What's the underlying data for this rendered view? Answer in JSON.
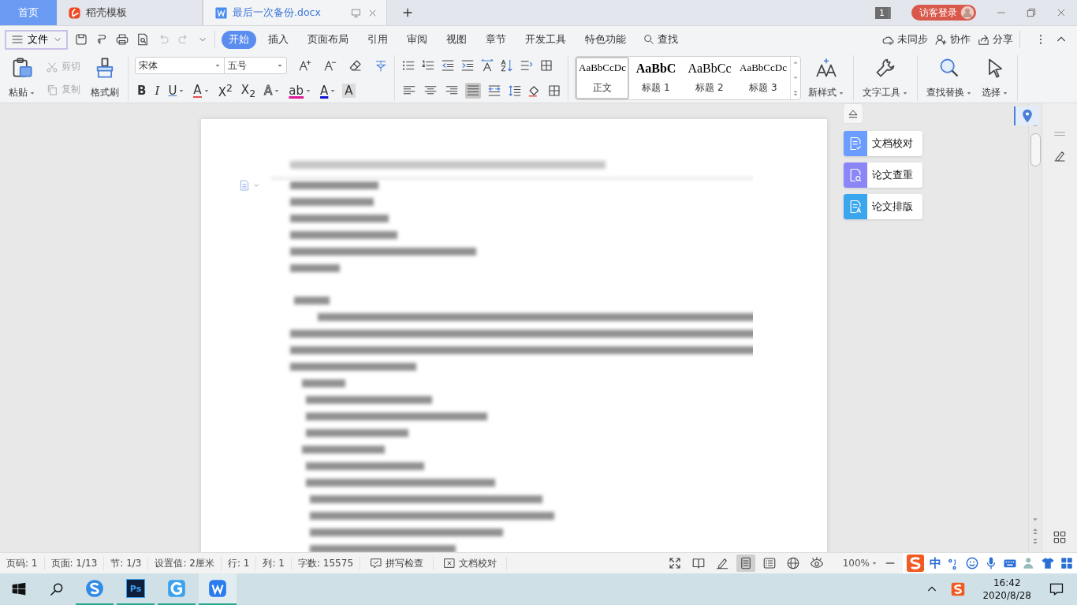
{
  "tabs": [
    {
      "kind": "home",
      "label": "首页",
      "selected": false
    },
    {
      "kind": "template",
      "label": "稻壳模板",
      "selected": false
    },
    {
      "kind": "document",
      "label": "最后一次备份.docx",
      "selected": true
    }
  ],
  "window_badge": "1",
  "login_button": "访客登录",
  "file_menu": "文件",
  "menu_tabs": [
    {
      "label": "开始",
      "selected": true
    },
    {
      "label": "插入",
      "selected": false
    },
    {
      "label": "页面布局",
      "selected": false
    },
    {
      "label": "引用",
      "selected": false
    },
    {
      "label": "审阅",
      "selected": false
    },
    {
      "label": "视图",
      "selected": false
    },
    {
      "label": "章节",
      "selected": false
    },
    {
      "label": "开发工具",
      "selected": false
    },
    {
      "label": "特色功能",
      "selected": false
    }
  ],
  "search_label": "查找",
  "cloud_actions": [
    {
      "kind": "sync",
      "label": "未同步"
    },
    {
      "kind": "collab",
      "label": "协作"
    },
    {
      "kind": "share",
      "label": "分享"
    }
  ],
  "ribbon": {
    "paste": "粘贴",
    "cut": {
      "label": "剪切",
      "disabled": true
    },
    "copy": {
      "label": "复制",
      "disabled": true
    },
    "format_painter": "格式刷",
    "font_name": "宋体",
    "font_size": "五号",
    "format_buttons": [
      {
        "kind": "bold",
        "label": "B"
      },
      {
        "kind": "italic",
        "label": "I"
      },
      {
        "kind": "underline",
        "label": "U"
      },
      {
        "kind": "strike",
        "label": "A"
      },
      {
        "kind": "sup",
        "label": "X$^{2}$"
      },
      {
        "kind": "sub",
        "label": "X$_{2}$"
      },
      {
        "kind": "outline",
        "label": "A"
      },
      {
        "kind": "highlight",
        "label": "ab"
      },
      {
        "kind": "color",
        "label": "A"
      },
      {
        "kind": "shade",
        "label": "A"
      }
    ],
    "alignments": [
      {
        "kind": "left",
        "selected": false
      },
      {
        "kind": "center",
        "selected": false
      },
      {
        "kind": "right",
        "selected": false
      },
      {
        "kind": "justify",
        "selected": true
      },
      {
        "kind": "distributed",
        "selected": false
      }
    ],
    "styles": [
      {
        "kind": "body",
        "sample": "AaBbCcDc",
        "label": "正文",
        "selected": true
      },
      {
        "kind": "h1",
        "sample": "AaBbC",
        "label": "标题 1",
        "selected": false
      },
      {
        "kind": "h2",
        "sample": "AaBbCc",
        "label": "标题 2",
        "selected": false
      },
      {
        "kind": "h3",
        "sample": "AaBbCcDc",
        "label": "标题 3",
        "selected": false
      }
    ],
    "new_style": "新样式",
    "text_tools": "文字工具",
    "find_replace": "查找替换",
    "select": "选择"
  },
  "side_tools": [
    {
      "kind": "proofread",
      "label": "文档校对",
      "color": "#6b9cff"
    },
    {
      "kind": "plagiarism",
      "label": "论文查重",
      "color": "#8b86f7"
    },
    {
      "kind": "layout",
      "label": "论文排版",
      "color": "#3aa6ee"
    }
  ],
  "status_bar": {
    "items": [
      "页码: 1",
      "页面: 1/13",
      "节: 1/3",
      "设置值: 2厘米",
      "行: 1",
      "列: 1",
      "字数: 15575"
    ],
    "tools": [
      {
        "kind": "spell",
        "label": "拼写检查"
      },
      {
        "kind": "proof",
        "label": "文档校对"
      }
    ],
    "views": [
      {
        "kind": "fullscreen",
        "selected": false
      },
      {
        "kind": "reading",
        "selected": false
      },
      {
        "kind": "write",
        "selected": false
      },
      {
        "kind": "page",
        "selected": true
      },
      {
        "kind": "outline",
        "selected": false
      },
      {
        "kind": "web",
        "selected": false
      },
      {
        "kind": "eye",
        "selected": false
      }
    ],
    "zoom": "100%"
  },
  "ime_toolbar": {
    "mode": "中"
  },
  "taskbar": {
    "apps": [
      {
        "kind": "browser",
        "selected": false
      },
      {
        "kind": "photoshop",
        "label": "Ps",
        "selected": false
      },
      {
        "kind": "g-app",
        "selected": false
      },
      {
        "kind": "wps",
        "selected": true
      }
    ],
    "time": "16:42",
    "date": "2020/8/28"
  }
}
